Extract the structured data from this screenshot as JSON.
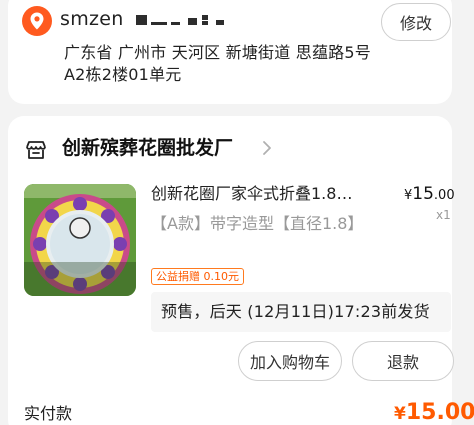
{
  "address_card": {
    "recipient_name": "smzen",
    "edit_label": "修改",
    "address_text": "广东省 广州市 天河区 新塘街道 思蕴路5号A2栋2楼01单元"
  },
  "order": {
    "shop_name": "创新殡葬花圈批发厂",
    "product": {
      "title": "创新花圈厂家伞式折叠1.8…",
      "spec": "【A款】带字造型【直径1.8】",
      "price_currency": "¥",
      "price_int": "15",
      "price_dec": ".00",
      "quantity": "x1",
      "image_caption": "一路走好",
      "charity_badge": "公益捐赠 0.10元",
      "presale_text": "预售，后天 (12月11日)17:23前发货"
    },
    "actions": {
      "add_to_cart": "加入购物车",
      "refund": "退款"
    },
    "paid": {
      "label": "实付款",
      "currency": "¥",
      "amount": "15.00"
    }
  },
  "colors": {
    "accent": "#ff5a00",
    "location_icon_bg": "#ff5a1f",
    "background": "#f3f3f3"
  }
}
